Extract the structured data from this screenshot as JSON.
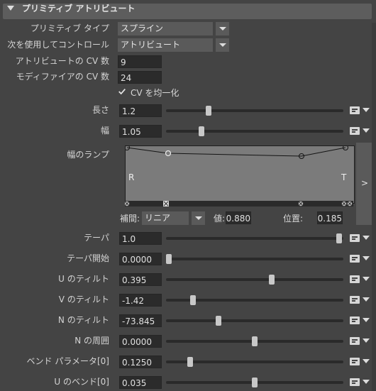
{
  "header": {
    "title": "プリミティブ アトリビュート"
  },
  "rows_top": {
    "prim_type_label": "プリミティブ タイプ",
    "prim_type_value": "スプライン",
    "control_label": "次を使用してコントロール",
    "control_value": "アトリビュート",
    "attr_cv_label": "アトリビュートの CV 数",
    "attr_cv_value": "9",
    "mod_cv_label": "モディファイアの CV 数",
    "mod_cv_value": "24",
    "uniform_label": "CV を均一化",
    "uniform_checked": true
  },
  "sliders_a": [
    {
      "label": "長さ",
      "value": "1.2",
      "pos": 0.23
    },
    {
      "label": "幅",
      "value": "1.05",
      "pos": 0.19
    }
  ],
  "ramp": {
    "label": "幅のランプ",
    "left_label": "R",
    "right_label": "T",
    "expand_label": ">",
    "interp_label": "補間:",
    "interp_value": "リニア",
    "value_label": "値:",
    "value_value": "0.880",
    "position_label": "位置:",
    "position_value": "0.185"
  },
  "sliders_b": [
    {
      "label": "テーパ",
      "value": "1.0",
      "pos": 0.99
    },
    {
      "label": "テーパ開始",
      "value": "0.0000",
      "pos": 0.0
    },
    {
      "label": "U のティルト",
      "value": "0.395",
      "pos": 0.6
    },
    {
      "label": "V のティルト",
      "value": "-1.42",
      "pos": 0.14
    },
    {
      "label": "N のティルト",
      "value": "-73.845",
      "pos": 0.29
    },
    {
      "label": "N の周囲",
      "value": "0.0000",
      "pos": 0.5
    },
    {
      "label": "ベンド パラメータ[0]",
      "value": "0.1250",
      "pos": 0.125
    },
    {
      "label": "U のベンド[0]",
      "value": "0.035",
      "pos": 0.5
    }
  ],
  "icons": {
    "map": "map-button-icon",
    "dropdown": "chevron-down-icon",
    "check": "check-icon"
  }
}
